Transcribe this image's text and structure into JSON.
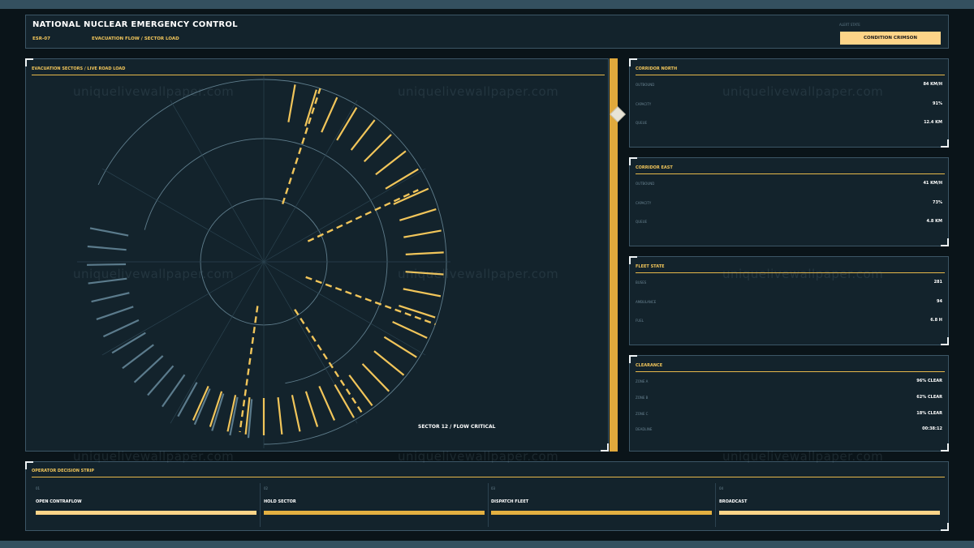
{
  "header": {
    "title": "NATIONAL NUCLEAR EMERGENCY CONTROL",
    "id": "ESR-07",
    "subtitle": "EVACUATION FLOW / SECTOR LOAD",
    "alert_label": "ALERT STATE",
    "alert_value": "CONDITION CRIMSON"
  },
  "main_panel": {
    "title": "EVACUATION SECTORS / LIVE ROAD LOAD",
    "status": "SECTOR 12 / FLOW CRITICAL"
  },
  "side_panels": [
    {
      "title": "CORRIDOR NORTH",
      "rows": [
        {
          "label": "OUTBOUND",
          "value": "84 KM/H"
        },
        {
          "label": "CAPACITY",
          "value": "91%"
        },
        {
          "label": "QUEUE",
          "value": "12.4 KM"
        }
      ]
    },
    {
      "title": "CORRIDOR EAST",
      "rows": [
        {
          "label": "OUTBOUND",
          "value": "41 KM/H"
        },
        {
          "label": "CAPACITY",
          "value": "73%"
        },
        {
          "label": "QUEUE",
          "value": "4.8 KM"
        }
      ]
    },
    {
      "title": "FLEET STATE",
      "rows": [
        {
          "label": "BUSES",
          "value": "281"
        },
        {
          "label": "AMBULANCE",
          "value": "94"
        },
        {
          "label": "FUEL",
          "value": "6.8 H"
        }
      ]
    },
    {
      "title": "CLEARANCE",
      "rows": [
        {
          "label": "ZONE A",
          "value": "96% CLEAR"
        },
        {
          "label": "ZONE B",
          "value": "62% CLEAR"
        },
        {
          "label": "ZONE C",
          "value": "18% CLEAR"
        },
        {
          "label": "DEADLINE",
          "value": "00:38:12"
        }
      ]
    }
  ],
  "decision_strip": {
    "title": "OPERATOR DECISION STRIP",
    "items": [
      {
        "num": "01",
        "label": "OPEN CONTRAFLOW",
        "color": "#fdd488"
      },
      {
        "num": "02",
        "label": "HOLD SECTOR",
        "color": "#e3b041"
      },
      {
        "num": "03",
        "label": "DISPATCH FLEET",
        "color": "#e3b041"
      },
      {
        "num": "04",
        "label": "BROADCAST",
        "color": "#fdd488"
      }
    ]
  },
  "watermark": "uniquelivewallpaper.com",
  "colors": {
    "accent": "#f1c55a",
    "accent_strong": "#e3b041",
    "alert": "#fdd488",
    "panel": "#13232c"
  }
}
